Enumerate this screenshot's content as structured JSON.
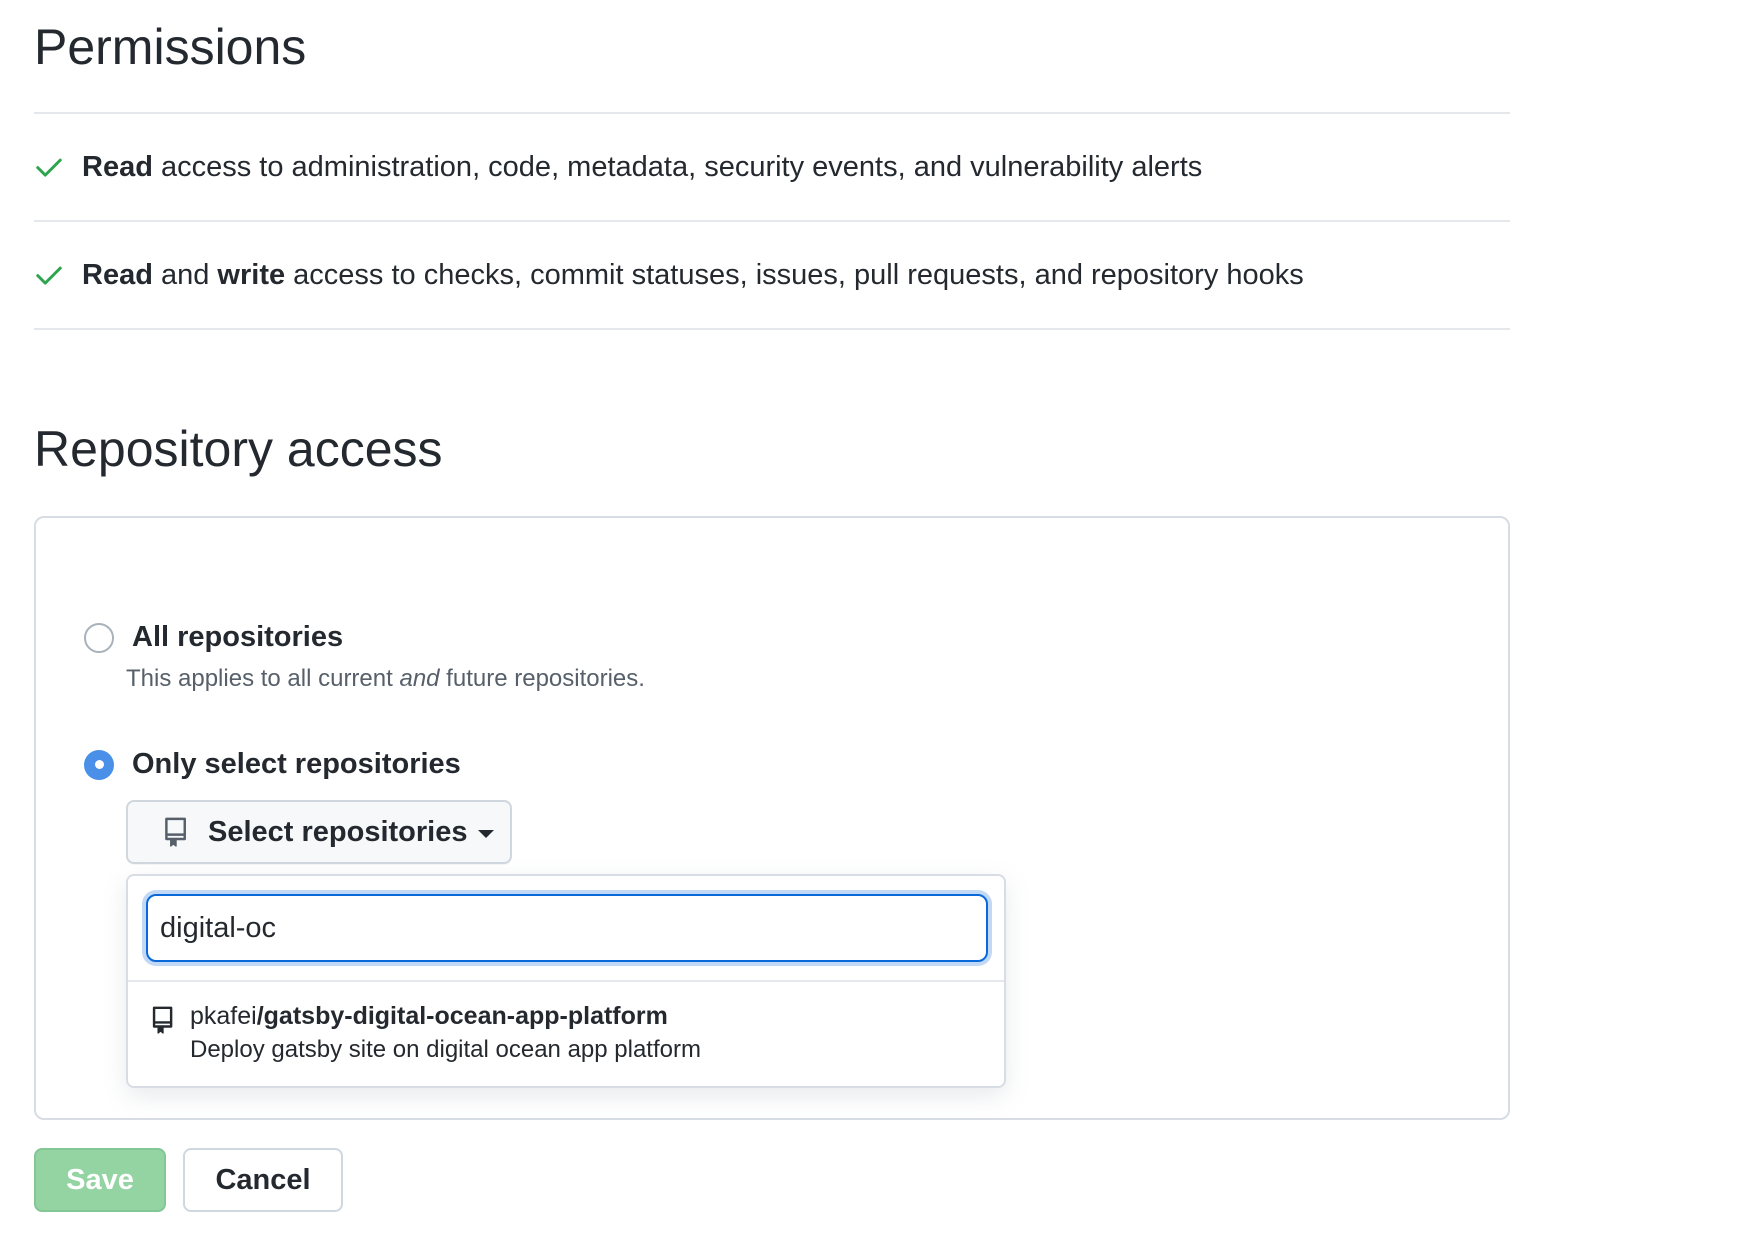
{
  "permissions": {
    "title": "Permissions",
    "items": [
      {
        "bold1": "Read",
        "mid": "",
        "bold2": "",
        "rest": " access to administration, code, metadata, security events, and vulnerability alerts"
      },
      {
        "bold1": "Read",
        "mid": " and ",
        "bold2": "write",
        "rest": " access to checks, commit statuses, issues, pull requests, and repository hooks"
      }
    ]
  },
  "repository_access": {
    "title": "Repository access",
    "options": {
      "all": {
        "label": "All repositories",
        "desc_before": "This applies to all current ",
        "desc_emph": "and",
        "desc_after": " future repositories.",
        "checked": false
      },
      "select": {
        "label": "Only select repositories",
        "checked": true
      }
    },
    "select_button": {
      "label": "Select repositories"
    },
    "dropdown": {
      "search_value": "digital-oc",
      "results": [
        {
          "owner": "pkafei",
          "repo": "/gatsby-digital-ocean-app-platform",
          "description": "Deploy gatsby site on digital ocean app platform"
        }
      ]
    }
  },
  "actions": {
    "save_label": "Save",
    "cancel_label": "Cancel"
  },
  "colors": {
    "check": "#2da44e",
    "radio_selected": "#4a90e8",
    "focus_border": "#0969da",
    "save_disabled_bg": "#94d3a2"
  },
  "icons": {
    "check": "check-icon",
    "repo": "repo-icon",
    "caret": "caret-down-icon"
  }
}
